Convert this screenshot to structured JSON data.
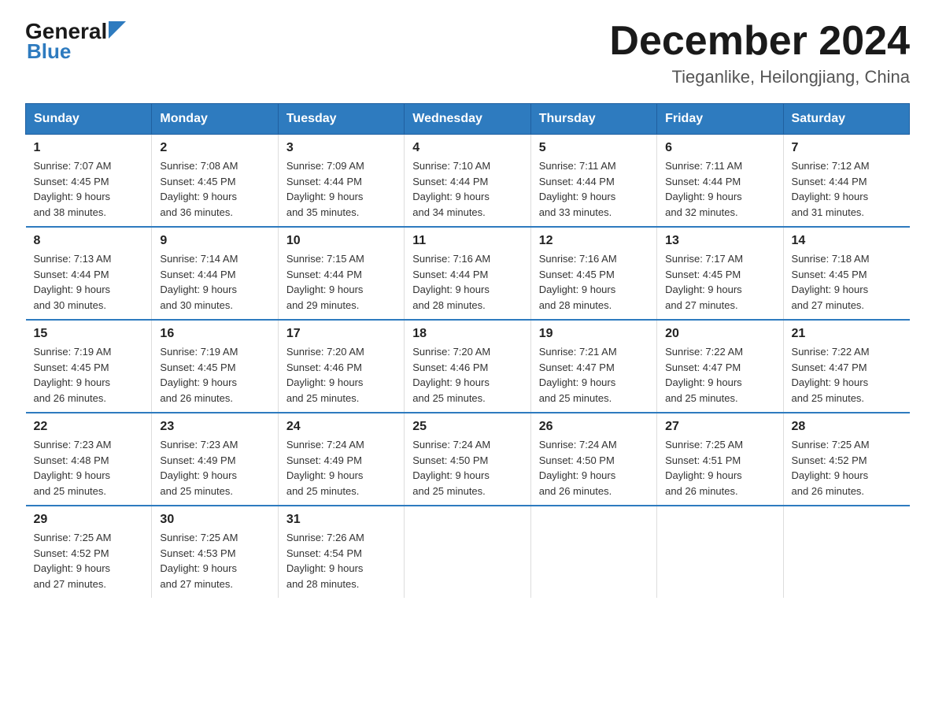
{
  "header": {
    "logo_general": "General",
    "logo_blue": "Blue",
    "month_title": "December 2024",
    "location": "Tieganlike, Heilongjiang, China"
  },
  "days_of_week": [
    "Sunday",
    "Monday",
    "Tuesday",
    "Wednesday",
    "Thursday",
    "Friday",
    "Saturday"
  ],
  "weeks": [
    [
      {
        "day": "1",
        "sunrise": "7:07 AM",
        "sunset": "4:45 PM",
        "daylight": "9 hours and 38 minutes."
      },
      {
        "day": "2",
        "sunrise": "7:08 AM",
        "sunset": "4:45 PM",
        "daylight": "9 hours and 36 minutes."
      },
      {
        "day": "3",
        "sunrise": "7:09 AM",
        "sunset": "4:44 PM",
        "daylight": "9 hours and 35 minutes."
      },
      {
        "day": "4",
        "sunrise": "7:10 AM",
        "sunset": "4:44 PM",
        "daylight": "9 hours and 34 minutes."
      },
      {
        "day": "5",
        "sunrise": "7:11 AM",
        "sunset": "4:44 PM",
        "daylight": "9 hours and 33 minutes."
      },
      {
        "day": "6",
        "sunrise": "7:11 AM",
        "sunset": "4:44 PM",
        "daylight": "9 hours and 32 minutes."
      },
      {
        "day": "7",
        "sunrise": "7:12 AM",
        "sunset": "4:44 PM",
        "daylight": "9 hours and 31 minutes."
      }
    ],
    [
      {
        "day": "8",
        "sunrise": "7:13 AM",
        "sunset": "4:44 PM",
        "daylight": "9 hours and 30 minutes."
      },
      {
        "day": "9",
        "sunrise": "7:14 AM",
        "sunset": "4:44 PM",
        "daylight": "9 hours and 30 minutes."
      },
      {
        "day": "10",
        "sunrise": "7:15 AM",
        "sunset": "4:44 PM",
        "daylight": "9 hours and 29 minutes."
      },
      {
        "day": "11",
        "sunrise": "7:16 AM",
        "sunset": "4:44 PM",
        "daylight": "9 hours and 28 minutes."
      },
      {
        "day": "12",
        "sunrise": "7:16 AM",
        "sunset": "4:45 PM",
        "daylight": "9 hours and 28 minutes."
      },
      {
        "day": "13",
        "sunrise": "7:17 AM",
        "sunset": "4:45 PM",
        "daylight": "9 hours and 27 minutes."
      },
      {
        "day": "14",
        "sunrise": "7:18 AM",
        "sunset": "4:45 PM",
        "daylight": "9 hours and 27 minutes."
      }
    ],
    [
      {
        "day": "15",
        "sunrise": "7:19 AM",
        "sunset": "4:45 PM",
        "daylight": "9 hours and 26 minutes."
      },
      {
        "day": "16",
        "sunrise": "7:19 AM",
        "sunset": "4:45 PM",
        "daylight": "9 hours and 26 minutes."
      },
      {
        "day": "17",
        "sunrise": "7:20 AM",
        "sunset": "4:46 PM",
        "daylight": "9 hours and 25 minutes."
      },
      {
        "day": "18",
        "sunrise": "7:20 AM",
        "sunset": "4:46 PM",
        "daylight": "9 hours and 25 minutes."
      },
      {
        "day": "19",
        "sunrise": "7:21 AM",
        "sunset": "4:47 PM",
        "daylight": "9 hours and 25 minutes."
      },
      {
        "day": "20",
        "sunrise": "7:22 AM",
        "sunset": "4:47 PM",
        "daylight": "9 hours and 25 minutes."
      },
      {
        "day": "21",
        "sunrise": "7:22 AM",
        "sunset": "4:47 PM",
        "daylight": "9 hours and 25 minutes."
      }
    ],
    [
      {
        "day": "22",
        "sunrise": "7:23 AM",
        "sunset": "4:48 PM",
        "daylight": "9 hours and 25 minutes."
      },
      {
        "day": "23",
        "sunrise": "7:23 AM",
        "sunset": "4:49 PM",
        "daylight": "9 hours and 25 minutes."
      },
      {
        "day": "24",
        "sunrise": "7:24 AM",
        "sunset": "4:49 PM",
        "daylight": "9 hours and 25 minutes."
      },
      {
        "day": "25",
        "sunrise": "7:24 AM",
        "sunset": "4:50 PM",
        "daylight": "9 hours and 25 minutes."
      },
      {
        "day": "26",
        "sunrise": "7:24 AM",
        "sunset": "4:50 PM",
        "daylight": "9 hours and 26 minutes."
      },
      {
        "day": "27",
        "sunrise": "7:25 AM",
        "sunset": "4:51 PM",
        "daylight": "9 hours and 26 minutes."
      },
      {
        "day": "28",
        "sunrise": "7:25 AM",
        "sunset": "4:52 PM",
        "daylight": "9 hours and 26 minutes."
      }
    ],
    [
      {
        "day": "29",
        "sunrise": "7:25 AM",
        "sunset": "4:52 PM",
        "daylight": "9 hours and 27 minutes."
      },
      {
        "day": "30",
        "sunrise": "7:25 AM",
        "sunset": "4:53 PM",
        "daylight": "9 hours and 27 minutes."
      },
      {
        "day": "31",
        "sunrise": "7:26 AM",
        "sunset": "4:54 PM",
        "daylight": "9 hours and 28 minutes."
      },
      {
        "day": "",
        "sunrise": "",
        "sunset": "",
        "daylight": ""
      },
      {
        "day": "",
        "sunrise": "",
        "sunset": "",
        "daylight": ""
      },
      {
        "day": "",
        "sunrise": "",
        "sunset": "",
        "daylight": ""
      },
      {
        "day": "",
        "sunrise": "",
        "sunset": "",
        "daylight": ""
      }
    ]
  ],
  "labels": {
    "sunrise_prefix": "Sunrise: ",
    "sunset_prefix": "Sunset: ",
    "daylight_prefix": "Daylight: "
  }
}
